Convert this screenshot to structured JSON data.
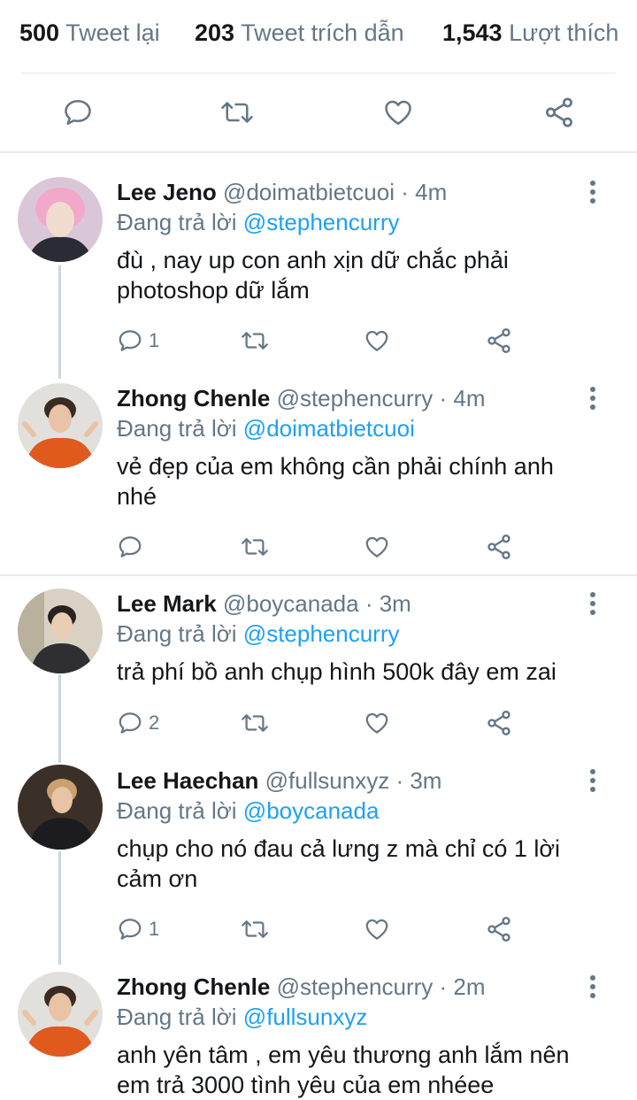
{
  "stats": {
    "retweets": {
      "count": "500",
      "label": "Tweet lại"
    },
    "quotes": {
      "count": "203",
      "label": "Tweet trích dẫn"
    },
    "likes": {
      "count": "1,543",
      "label": "Lượt thích"
    }
  },
  "main_actions": [
    "reply-icon",
    "retweet-icon",
    "like-icon",
    "share-icon"
  ],
  "replies": [
    {
      "name": "Lee Jeno",
      "handle": "@doimatbietcuoi",
      "time": "· 4m",
      "replying_prefix": "Đang trả lời",
      "replying_to": "@stephencurry",
      "text_lines": [
        "đù , nay up con anh xịn dữ chắc phải",
        "photoshop dữ lắm"
      ],
      "reply_count": "1",
      "avatar_colors": [
        "#f2a9c9",
        "#2b2b35"
      ]
    },
    {
      "name": "Zhong Chenle",
      "handle": "@stephencurry",
      "time": "· 4m",
      "replying_prefix": "Đang trả lời",
      "replying_to": "@doimatbietcuoi",
      "text_lines": [
        "vẻ đẹp của em không cần phải chính anh",
        "nhé"
      ],
      "reply_count": "",
      "avatar_colors": [
        "#e2e0dc",
        "#e05a1e"
      ]
    },
    {
      "name": "Lee Mark",
      "handle": "@boycanada",
      "time": "· 3m",
      "replying_prefix": "Đang trả lời",
      "replying_to": "@stephencurry",
      "text_lines": [
        "trả phí bồ anh chụp hình 500k đây em zai"
      ],
      "reply_count": "2",
      "avatar_colors": [
        "#d9d2c4",
        "#2f2f33"
      ]
    },
    {
      "name": "Lee Haechan",
      "handle": "@fullsunxyz",
      "time": "· 3m",
      "replying_prefix": "Đang trả lời",
      "replying_to": "@boycanada",
      "text_lines": [
        "chụp cho nó đau cả lưng z mà chỉ có 1 lời",
        "cảm ơn"
      ],
      "reply_count": "1",
      "avatar_colors": [
        "#3a3028",
        "#1c1c20"
      ]
    },
    {
      "name": "Zhong Chenle",
      "handle": "@stephencurry",
      "time": "· 2m",
      "replying_prefix": "Đang trả lời",
      "replying_to": "@fullsunxyz",
      "text_lines": [
        "anh yên tâm , em yêu thương anh lắm nên",
        "em trả 3000 tình yêu của em nhéee"
      ],
      "reply_count": "",
      "avatar_colors": [
        "#e2e0dc",
        "#e05a1e"
      ]
    }
  ]
}
